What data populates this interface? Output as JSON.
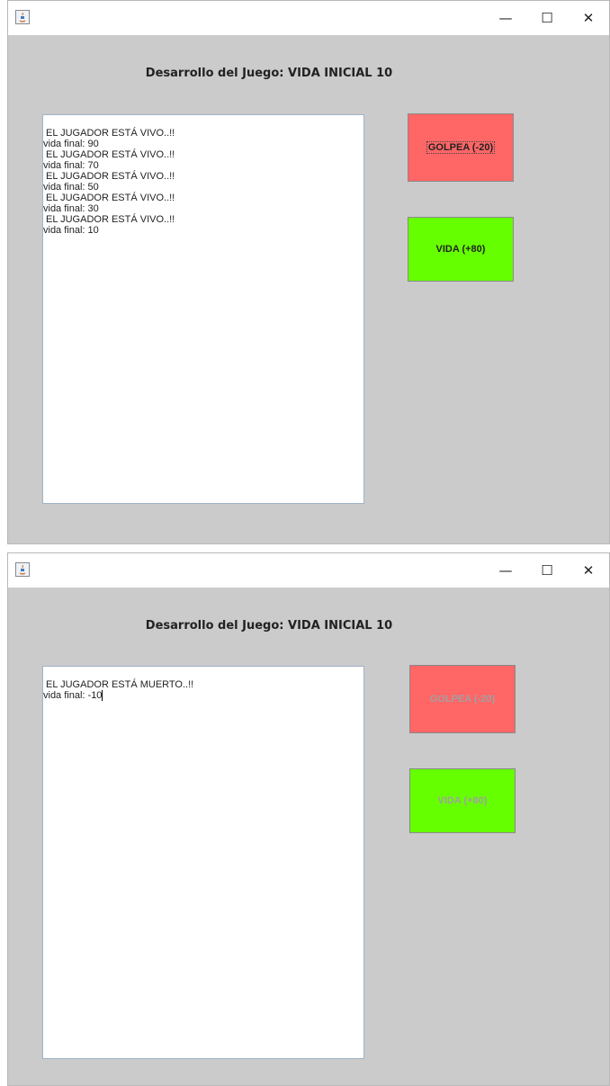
{
  "colors": {
    "panel_bg": "#cbcbcb",
    "golpea_button": "#ff6666",
    "vida_button": "#66ff00",
    "disabled_text": "#a0a0a0"
  },
  "window_controls": {
    "minimize": "—",
    "maximize": "☐",
    "close": "✕"
  },
  "windows": [
    {
      "heading": "Desarrollo del Juego: VIDA INICIAL 10",
      "log": [
        "EL JUGADOR ESTÁ VIVO..!!",
        "vida final: 90",
        "EL JUGADOR ESTÁ VIVO..!!",
        "vida final: 70",
        "EL JUGADOR ESTÁ VIVO..!!",
        "vida final: 50",
        "EL JUGADOR ESTÁ VIVO..!!",
        "vida final: 30",
        "EL JUGADOR ESTÁ VIVO..!!",
        "vida final: 10"
      ],
      "buttons": {
        "golpea": "GOLPEA (-20)",
        "vida": "VIDA (+80)",
        "enabled": true
      }
    },
    {
      "heading": "Desarrollo del Juego: VIDA INICIAL 10",
      "log": [
        "EL JUGADOR ESTÁ MUERTO..!!",
        "vida final: -10"
      ],
      "buttons": {
        "golpea": "GOLPEA (-20)",
        "vida": "VIDA (+80)",
        "enabled": false
      }
    }
  ]
}
